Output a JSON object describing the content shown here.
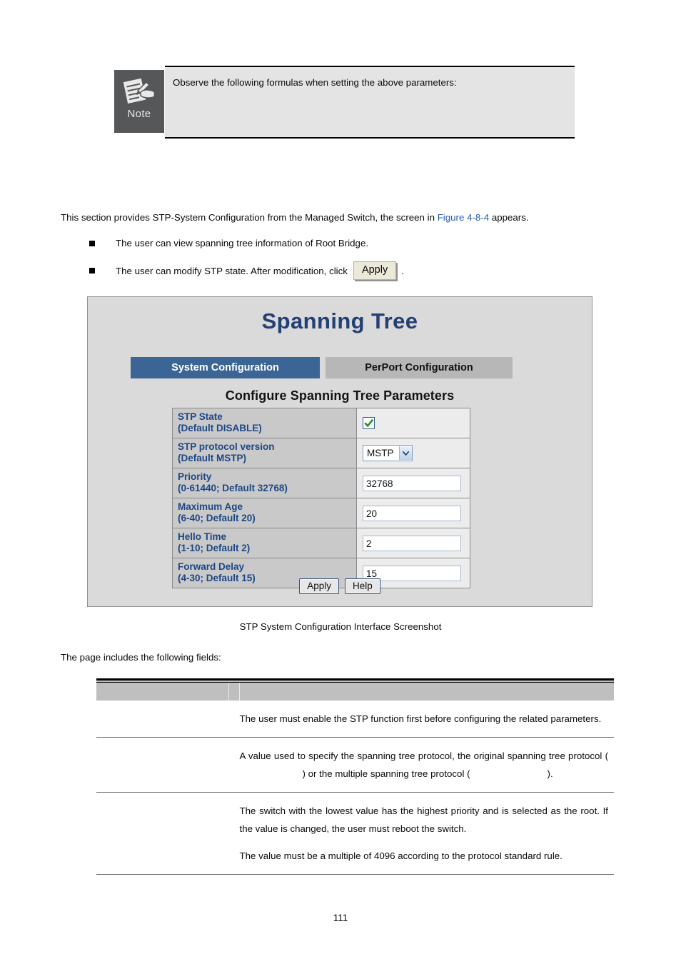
{
  "note": {
    "icon_label": "Note",
    "text": "Observe the following formulas when setting the above parameters:"
  },
  "intro": {
    "before_link": "This section provides STP-System Configuration from the Managed Switch, the screen in ",
    "link": "Figure 4-8-4",
    "after_link": " appears.",
    "bullets": [
      {
        "text": "The user can view spanning tree information of Root Bridge."
      },
      {
        "text_before": "The user can modify STP state. After modification, click",
        "button_label": "Apply",
        "text_after": "."
      }
    ]
  },
  "figure": {
    "title": "Spanning Tree",
    "tabs": [
      {
        "label": "System Configuration",
        "active": true
      },
      {
        "label": "PerPort Configuration",
        "active": false
      }
    ],
    "section_heading": "Configure Spanning Tree Parameters",
    "rows": [
      {
        "label_line1": "STP State",
        "label_line2": "(Default DISABLE)",
        "control": "checkbox",
        "value": "checked"
      },
      {
        "label_line1": "STP protocol version",
        "label_line2": "(Default MSTP)",
        "control": "select",
        "value": "MSTP"
      },
      {
        "label_line1": "Priority",
        "label_line2": "(0-61440; Default 32768)",
        "control": "text",
        "value": "32768"
      },
      {
        "label_line1": "Maximum Age",
        "label_line2": "(6-40; Default 20)",
        "control": "text",
        "value": "20"
      },
      {
        "label_line1": "Hello Time",
        "label_line2": "(1-10; Default 2)",
        "control": "text",
        "value": "2"
      },
      {
        "label_line1": "Forward Delay",
        "label_line2": "(4-30; Default 15)",
        "control": "text",
        "value": "15"
      }
    ],
    "apply_label": "Apply",
    "help_label": "Help",
    "caption": "STP System Configuration Interface Screenshot"
  },
  "fields_section": {
    "intro": "The page includes the following fields:",
    "header": {
      "col1": "",
      "col2": "",
      "col3": ""
    },
    "rows": [
      {
        "term": "",
        "paragraphs": [
          "The user must enable the STP function first before configuring the related parameters."
        ]
      },
      {
        "term": "",
        "paragraphs": [
          "A value used to specify the spanning tree protocol, the original spanning tree protocol (          ) or the multiple spanning tree protocol (          )."
        ]
      },
      {
        "term": "",
        "paragraphs": [
          "The switch with the lowest value has the highest priority and is selected as the root. If the value is changed, the user must reboot the switch.",
          "The value must be a multiple of 4096 according to the protocol standard rule."
        ]
      }
    ],
    "desc_2_part1": "A value used to specify the spanning tree protocol, the original spanning tree protocol (",
    "desc_2_part2": ") or the multiple spanning tree protocol (",
    "desc_2_part3": ")."
  },
  "colors": {
    "title_blue": "#243f73",
    "tab_active_bg": "#3b6595",
    "label_blue": "#1d4785",
    "link_blue": "#2a5db0",
    "note_icon_bg": "#555759"
  },
  "page_number": "111"
}
